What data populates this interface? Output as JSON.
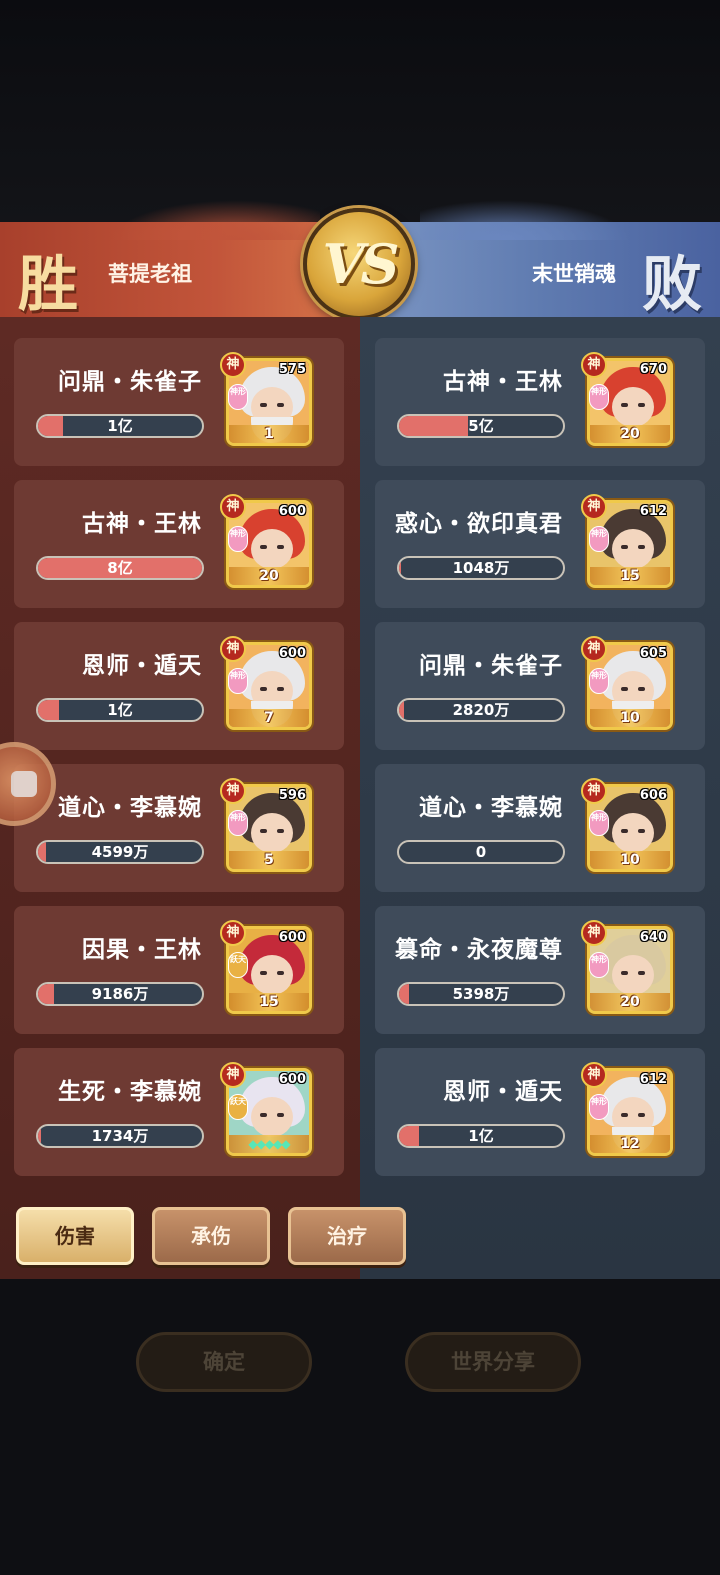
{
  "header": {
    "win_label": "胜",
    "lose_label": "败",
    "vs_label": "VS",
    "left_player": "菩提老祖",
    "right_player": "末世销魂"
  },
  "left_team": [
    {
      "name": "问鼎・朱雀子",
      "value": "1亿",
      "fill_pct": 15,
      "level": "575",
      "stars": "1",
      "sub": "神形",
      "theme": "white"
    },
    {
      "name": "古神・王林",
      "value": "8亿",
      "fill_pct": 100,
      "level": "600",
      "stars": "20",
      "sub": "神形",
      "theme": "red"
    },
    {
      "name": "恩师・遁天",
      "value": "1亿",
      "fill_pct": 13,
      "level": "600",
      "stars": "7",
      "sub": "神形",
      "theme": "white"
    },
    {
      "name": "道心・李慕婉",
      "value": "4599万",
      "fill_pct": 5,
      "level": "596",
      "stars": "5",
      "sub": "神形",
      "theme": "dark"
    },
    {
      "name": "因果・王林",
      "value": "9186万",
      "fill_pct": 10,
      "level": "600",
      "stars": "15",
      "sub": "跃天",
      "theme": "crimson"
    },
    {
      "name": "生死・李慕婉",
      "value": "1734万",
      "fill_pct": 2,
      "level": "600",
      "stars": "◆◆◆◆◆",
      "sub": "跃天",
      "theme": "silver"
    }
  ],
  "right_team": [
    {
      "name": "古神・王林",
      "value": "5亿",
      "fill_pct": 42,
      "level": "670",
      "stars": "20",
      "sub": "神形",
      "theme": "red"
    },
    {
      "name": "惑心・欲印真君",
      "value": "1048万",
      "fill_pct": 1,
      "level": "612",
      "stars": "15",
      "sub": "神形",
      "theme": "dark"
    },
    {
      "name": "问鼎・朱雀子",
      "value": "2820万",
      "fill_pct": 3,
      "level": "605",
      "stars": "10",
      "sub": "神形",
      "theme": "white"
    },
    {
      "name": "道心・李慕婉",
      "value": "0",
      "fill_pct": 0,
      "level": "606",
      "stars": "10",
      "sub": "神形",
      "theme": "dark"
    },
    {
      "name": "篡命・永夜魔尊",
      "value": "5398万",
      "fill_pct": 6,
      "level": "640",
      "stars": "20",
      "sub": "神形",
      "theme": "gold"
    },
    {
      "name": "恩师・遁天",
      "value": "1亿",
      "fill_pct": 12,
      "level": "612",
      "stars": "12",
      "sub": "神形",
      "theme": "white"
    }
  ],
  "god_badge": "神",
  "tabs": [
    {
      "label": "伤害",
      "active": true
    },
    {
      "label": "承伤",
      "active": false
    },
    {
      "label": "治疗",
      "active": false
    }
  ],
  "buttons": {
    "confirm": "确定",
    "share": "世界分享"
  },
  "colors": {
    "win_red": "#c2553a",
    "lose_blue": "#5f7bb0",
    "bar_fill": "#e2706a",
    "gold": "#f0c94a"
  }
}
